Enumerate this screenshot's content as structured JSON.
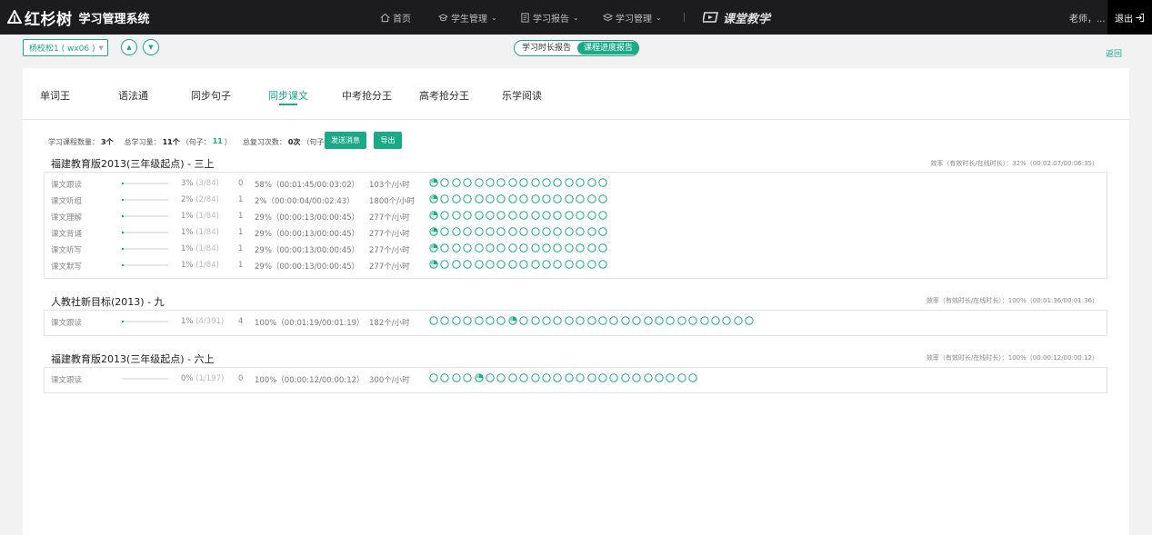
{
  "header": {
    "brand": "红杉树",
    "system": "学习管理系统",
    "nav": [
      {
        "label": "首页",
        "icon": "home-icon",
        "has_caret": false
      },
      {
        "label": "学生管理",
        "icon": "cap-icon",
        "has_caret": true
      },
      {
        "label": "学习报告",
        "icon": "report-icon",
        "has_caret": true
      },
      {
        "label": "学习管理",
        "icon": "layers-icon",
        "has_caret": true
      }
    ],
    "ketang": "课堂教学",
    "user": "老师，... ",
    "logout": "退出"
  },
  "subbar": {
    "student": "杨校松1 ( wx06 )",
    "segments": [
      "学习时长报告",
      "课程进度报告"
    ],
    "active_segment": 1,
    "back": "返回"
  },
  "tabs": [
    "单词王",
    "语法通",
    "同步句子",
    "同步课文",
    "中考抢分王",
    "高考抢分王",
    "乐学阅读"
  ],
  "active_tab": 3,
  "summary": {
    "course_count_label": "学习课程数量：",
    "course_count": "3个",
    "total_label": "总学习量：",
    "total": "11个",
    "sentence_open": "（句子：",
    "sentence_total": "11",
    "close": "）",
    "review_label": "总复习次数：",
    "review": "0次",
    "review_sentence": "0",
    "send_btn": "发送消息",
    "export_btn": "导出"
  },
  "accent_color": "#1aaa86",
  "sections": [
    {
      "title": "福建教育版2013(三年级起点) - 三上",
      "efficiency": "效率（有效时长/在线时长）：32%（00:02:07/00:06:35）",
      "rows": [
        {
          "name": "课文跟读",
          "progress": 0.03,
          "pct": "3%",
          "frac": "(3/84)",
          "count": "0",
          "eff": "58%（00:01:45/00:03:02）",
          "speed": "103个/小时",
          "circles": 16,
          "partial": [
            0
          ]
        },
        {
          "name": "课文听组",
          "progress": 0.02,
          "pct": "2%",
          "frac": "(2/84)",
          "count": "1",
          "eff": "2%（00:00:04/00:02:43）",
          "speed": "1800个/小时",
          "circles": 16,
          "partial": [
            0
          ]
        },
        {
          "name": "课文理解",
          "progress": 0.01,
          "pct": "1%",
          "frac": "(1/84)",
          "count": "1",
          "eff": "29%（00:00:13/00:00:45）",
          "speed": "277个/小时",
          "circles": 16,
          "partial": [
            0
          ]
        },
        {
          "name": "课文背诵",
          "progress": 0.01,
          "pct": "1%",
          "frac": "(1/84)",
          "count": "1",
          "eff": "29%（00:00:13/00:00:45）",
          "speed": "277个/小时",
          "circles": 16,
          "partial": [
            0
          ]
        },
        {
          "name": "课文听写",
          "progress": 0.01,
          "pct": "1%",
          "frac": "(1/84)",
          "count": "1",
          "eff": "29%（00:00:13/00:00:45）",
          "speed": "277个/小时",
          "circles": 16,
          "partial": [
            0
          ]
        },
        {
          "name": "课文默写",
          "progress": 0.01,
          "pct": "1%",
          "frac": "(1/84)",
          "count": "1",
          "eff": "29%（00:00:13/00:00:45）",
          "speed": "277个/小时",
          "circles": 16,
          "partial": [
            0
          ]
        }
      ]
    },
    {
      "title": "人教社新目标(2013) - 九",
      "efficiency": "效率（有效时长/在线时长）：100%（00:01:36/00:01:36）",
      "rows": [
        {
          "name": "课文跟读",
          "progress": 0.01,
          "pct": "1%",
          "frac": "(4/391)",
          "count": "4",
          "eff": "100%（00:01:19/00:01:19）",
          "speed": "182个/小时",
          "circles": 29,
          "partial": [
            7
          ]
        }
      ]
    },
    {
      "title": "福建教育版2013(三年级起点) - 六上",
      "efficiency": "效率（有效时长/在线时长）：100%（00:00:12/00:00:12）",
      "rows": [
        {
          "name": "课文跟读",
          "progress": 0.0,
          "pct": "0%",
          "frac": "(1/197)",
          "count": "0",
          "eff": "100%（00:00:12/00:00:12）",
          "speed": "300个/小时",
          "circles": 24,
          "partial": [
            4
          ]
        }
      ]
    }
  ]
}
